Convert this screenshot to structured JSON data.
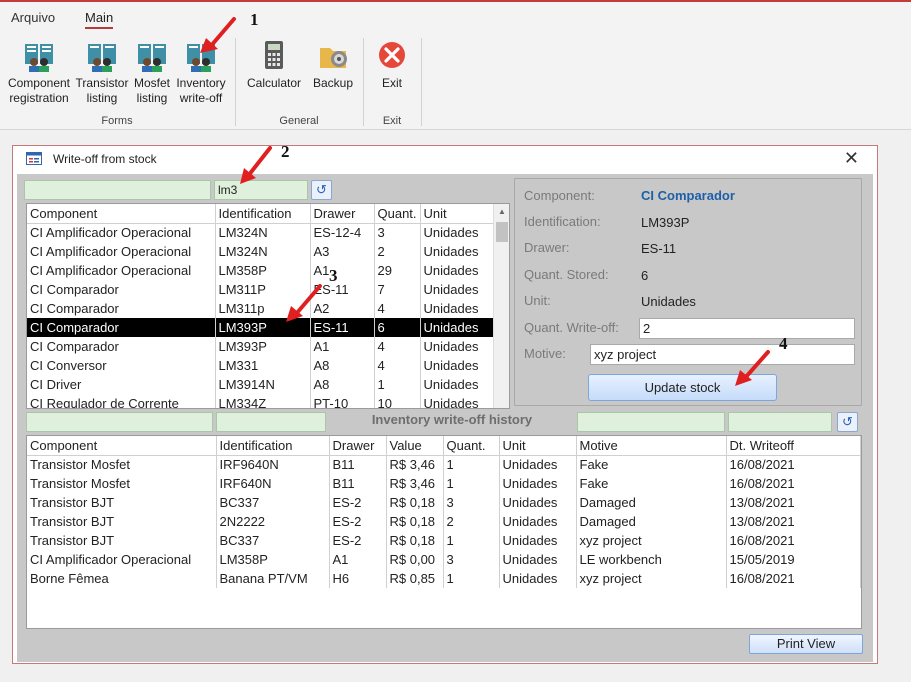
{
  "menu": {
    "tabs": [
      "Arquivo",
      "Main"
    ]
  },
  "ribbon": {
    "buttons": [
      {
        "label1": "Component",
        "label2": "registration"
      },
      {
        "label1": "Transistor",
        "label2": "listing"
      },
      {
        "label1": "Mosfet",
        "label2": "listing"
      },
      {
        "label1": "Inventory",
        "label2": "write-off"
      },
      {
        "label1": "Calculator",
        "label2": ""
      },
      {
        "label1": "Backup",
        "label2": ""
      },
      {
        "label1": "Exit",
        "label2": ""
      }
    ],
    "groups": [
      "Forms",
      "General",
      "Exit"
    ]
  },
  "dialog": {
    "title": "Write-off from stock",
    "filter_identification": "lm3",
    "top_columns": [
      "Component",
      "Identification",
      "Drawer",
      "Quant.",
      "Unit"
    ],
    "top_rows": [
      [
        "CI Amplificador Operacional",
        "LM324N",
        "ES-12-4",
        "3",
        "Unidades"
      ],
      [
        "CI Amplificador Operacional",
        "LM324N",
        "A3",
        "2",
        "Unidades"
      ],
      [
        "CI Amplificador Operacional",
        "LM358P",
        "A1",
        "29",
        "Unidades"
      ],
      [
        "CI Comparador",
        "LM311P",
        "ES-11",
        "7",
        "Unidades"
      ],
      [
        "CI Comparador",
        "LM311p",
        "A2",
        "4",
        "Unidades"
      ],
      [
        "CI Comparador",
        "LM393P",
        "ES-11",
        "6",
        "Unidades"
      ],
      [
        "CI Comparador",
        "LM393P",
        "A1",
        "4",
        "Unidades"
      ],
      [
        "CI Conversor",
        "LM331",
        "A8",
        "4",
        "Unidades"
      ],
      [
        "CI Driver",
        "LM3914N",
        "A8",
        "1",
        "Unidades"
      ],
      [
        "CI Regulador de Corrente",
        "LM334Z",
        "PT-10",
        "10",
        "Unidades"
      ]
    ],
    "detail": {
      "component_label": "Component:",
      "component_value": "CI Comparador",
      "identification_label": "Identification:",
      "identification_value": "LM393P",
      "drawer_label": "Drawer:",
      "drawer_value": "ES-11",
      "quant_label": "Quant. Stored:",
      "quant_value": "6",
      "unit_label": "Unit:",
      "unit_value": "Unidades",
      "writeoff_label": "Quant. Write-off:",
      "writeoff_value": "2",
      "motive_label": "Motive:",
      "motive_value": "xyz project",
      "update_button": "Update stock"
    },
    "history_title": "Inventory write-off history",
    "bottom_columns": [
      "Component",
      "Identification",
      "Drawer",
      "Value",
      "Quant.",
      "Unit",
      "Motive",
      "Dt. Writeoff"
    ],
    "bottom_rows": [
      [
        "Transistor Mosfet",
        "IRF9640N",
        "B11",
        "R$ 3,46",
        "1",
        "Unidades",
        "Fake",
        "16/08/2021"
      ],
      [
        "Transistor Mosfet",
        "IRF640N",
        "B11",
        "R$ 3,46",
        "1",
        "Unidades",
        "Fake",
        "16/08/2021"
      ],
      [
        "Transistor BJT",
        "BC337",
        "ES-2",
        "R$ 0,18",
        "3",
        "Unidades",
        "Damaged",
        "13/08/2021"
      ],
      [
        "Transistor BJT",
        "2N2222",
        "ES-2",
        "R$ 0,18",
        "2",
        "Unidades",
        "Damaged",
        "13/08/2021"
      ],
      [
        "Transistor BJT",
        "BC337",
        "ES-2",
        "R$ 0,18",
        "1",
        "Unidades",
        "xyz project",
        "16/08/2021"
      ],
      [
        "CI Amplificador Operacional",
        "LM358P",
        "A1",
        "R$ 0,00",
        "3",
        "Unidades",
        "LE workbench",
        "15/05/2019"
      ],
      [
        "Borne Fêmea",
        "Banana PT/VM",
        "H6",
        "R$ 0,85",
        "1",
        "Unidades",
        "xyz project",
        "16/08/2021"
      ]
    ],
    "print_button": "Print View"
  },
  "annotations": [
    "1",
    "2",
    "3",
    "4"
  ],
  "colors": {
    "accent_red": "#e02020",
    "filter_green": "#dff0dc",
    "selected_row": "#000000",
    "link_blue": "#1d5fa8"
  }
}
